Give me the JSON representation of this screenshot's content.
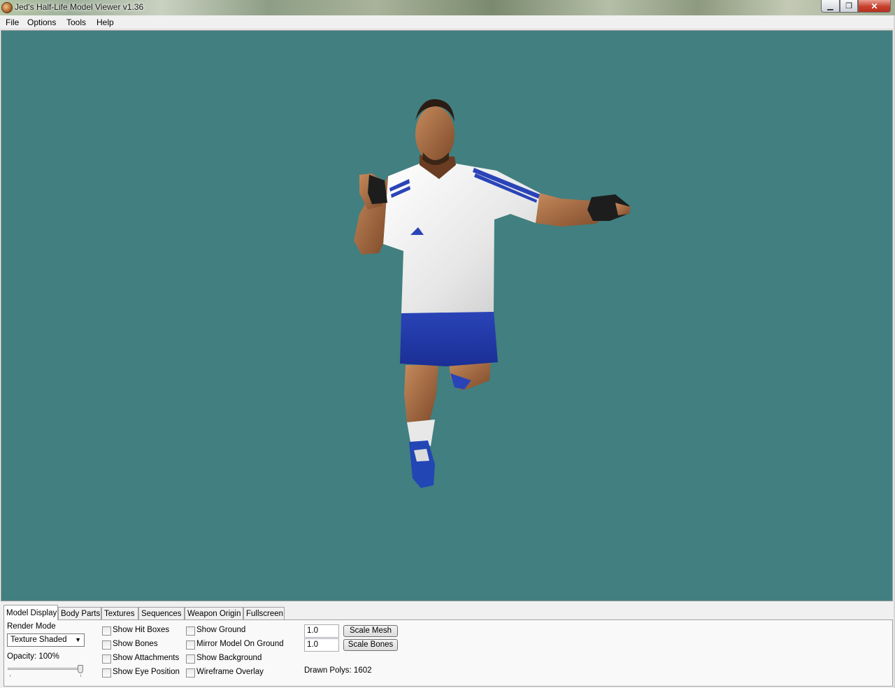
{
  "window": {
    "title": "Jed's Half-Life Model Viewer v1.36",
    "icon": "app-icon",
    "controls": {
      "minimize": "▁",
      "maximize": "❐",
      "close": "✕"
    }
  },
  "menu": [
    "File",
    "Options",
    "Tools",
    "Help"
  ],
  "viewport": {
    "background_color": "#417f80"
  },
  "tabs": [
    "Model Display",
    "Body Parts",
    "Textures",
    "Sequences",
    "Weapon Origin",
    "Fullscreen"
  ],
  "active_tab": "Model Display",
  "model_display": {
    "render_mode_label": "Render Mode",
    "render_mode_value": "Texture Shaded",
    "opacity_label": "Opacity: 100%",
    "opacity_value": 1.0,
    "checkboxes_col1": [
      "Show Hit Boxes",
      "Show Bones",
      "Show Attachments",
      "Show Eye Position"
    ],
    "checkboxes_col2": [
      "Show Ground",
      "Mirror Model On Ground",
      "Show Background",
      "Wireframe Overlay"
    ],
    "scale_mesh_value": "1.0",
    "scale_mesh_button": "Scale Mesh",
    "scale_bones_value": "1.0",
    "scale_bones_button": "Scale Bones",
    "drawn_polys": "Drawn Polys: 1602"
  }
}
